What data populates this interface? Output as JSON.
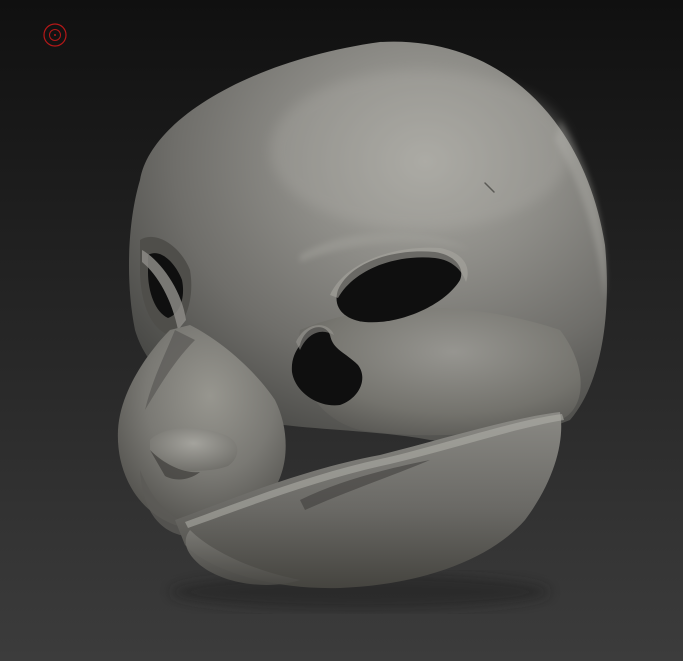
{
  "scene": {
    "subject": "",
    "background_top_color": "#101010",
    "background_bottom_color": "#3c3c3c",
    "material_base_color": "#7f7e79",
    "material_highlight_color": "#b0afa9",
    "material_shadow_color": "#3a3a37",
    "hole_color": "#0f0f0f"
  },
  "cursor": {
    "icon": "brush-cursor-icon",
    "color": "#b41818"
  }
}
